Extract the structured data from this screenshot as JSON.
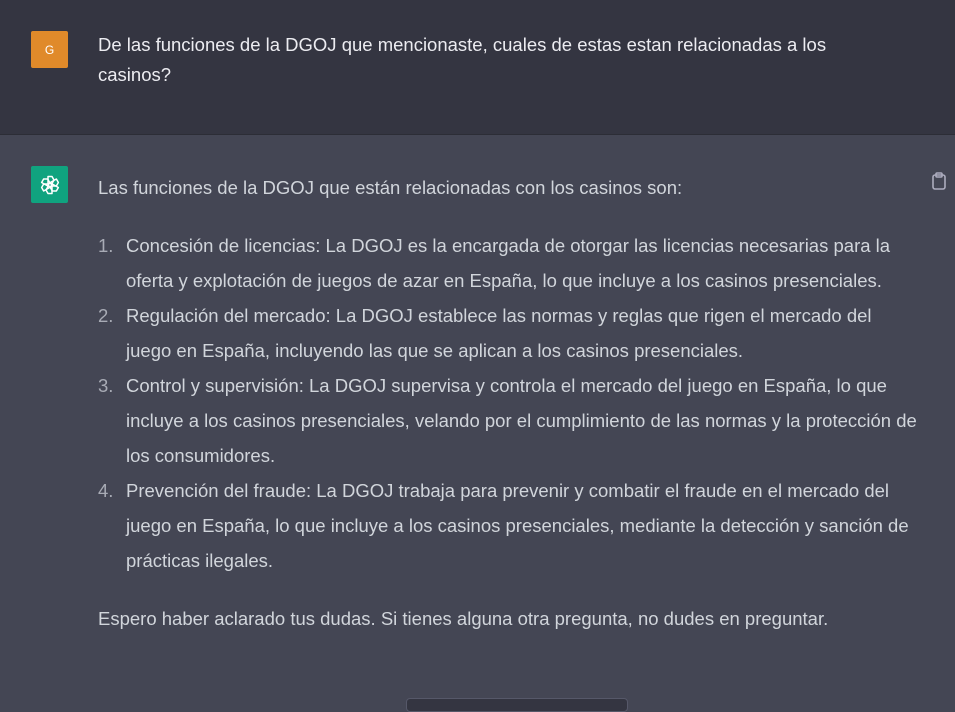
{
  "user_message": {
    "avatar_initial": "G",
    "avatar_color": "#e08a2a",
    "text": "De las funciones de la DGOJ que mencionaste, cuales de estas estan relacionadas a los casinos?"
  },
  "assistant_message": {
    "avatar_icon": "openai-logo-icon",
    "avatar_color": "#10a37f",
    "intro": "Las funciones de la DGOJ que están relacionadas con los casinos son:",
    "items": [
      {
        "number": "1.",
        "text": "Concesión de licencias: La DGOJ es la encargada de otorgar las licencias necesarias para la oferta y explotación de juegos de azar en España, lo que incluye a los casinos presenciales."
      },
      {
        "number": "2.",
        "text": "Regulación del mercado: La DGOJ establece las normas y reglas que rigen el mercado del juego en España, incluyendo las que se aplican a los casinos presenciales."
      },
      {
        "number": "3.",
        "text": "Control y supervisión: La DGOJ supervisa y controla el mercado del juego en España, lo que incluye a los casinos presenciales, velando por el cumplimiento de las normas y la protección de los consumidores."
      },
      {
        "number": "4.",
        "text": "Prevención del fraude: La DGOJ trabaja para prevenir y combatir el fraude en el mercado del juego en España, lo que incluye a los casinos presenciales, mediante la detección y sanción de prácticas ilegales."
      }
    ],
    "closing": "Espero haber aclarado tus dudas. Si tienes alguna otra pregunta, no dudes en preguntar.",
    "copy_icon": "clipboard-icon"
  },
  "colors": {
    "user_bg": "#343541",
    "assistant_bg": "#444654",
    "text": "#d1d5db"
  }
}
